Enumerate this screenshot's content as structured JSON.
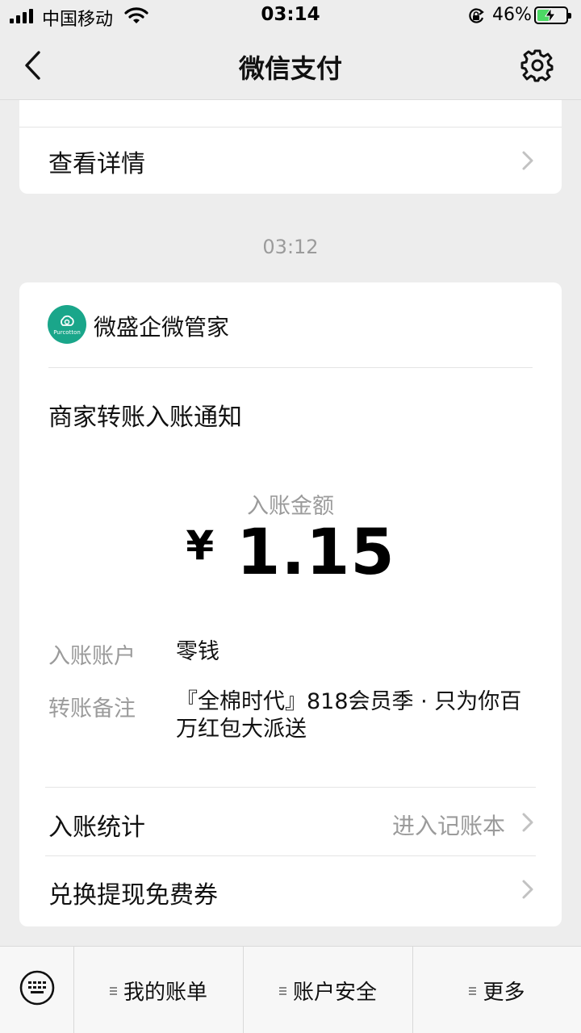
{
  "status_bar": {
    "carrier": "中国移动",
    "time": "03:14",
    "battery_percent": "46%",
    "battery_level": 0.46
  },
  "nav": {
    "title": "微信支付"
  },
  "prev_card": {
    "detail_label": "查看详情"
  },
  "message": {
    "timestamp": "03:12",
    "merchant_name": "微盛企微管家",
    "avatar_brand": "Purcotton",
    "notice_title": "商家转账入账通知",
    "amount_label": "入账金额",
    "currency": "¥",
    "amount": "1.15",
    "fields": [
      {
        "key": "入账账户",
        "value": "零钱"
      },
      {
        "key": "转账备注",
        "value": "『全棉时代』818会员季 · 只为你百万红包大派送"
      }
    ],
    "rows": [
      {
        "label": "入账统计",
        "right": "进入记账本"
      },
      {
        "label": "兑换提现免费券",
        "right": ""
      }
    ]
  },
  "tabbar": {
    "tabs": [
      {
        "label": "我的账单"
      },
      {
        "label": "账户安全"
      },
      {
        "label": "更多"
      }
    ]
  },
  "colors": {
    "accent_green": "#1aa68a",
    "battery_green": "#4cd964",
    "muted_text": "#9b9b9b"
  }
}
